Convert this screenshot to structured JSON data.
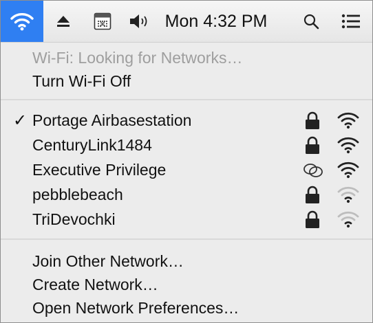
{
  "menubar": {
    "clock": "Mon 4:32 PM",
    "icons": [
      "wifi-icon",
      "eject-icon",
      "input-source-icon",
      "volume-icon",
      "spotlight-search-icon",
      "notification-list-icon"
    ]
  },
  "wifi_menu": {
    "status": "Wi-Fi: Looking for Networks…",
    "toggle": "Turn Wi-Fi Off",
    "check_mark": "✓",
    "networks": [
      {
        "name": "Portage Airbasestation",
        "selected": true,
        "security": "lock",
        "signal": 1.0
      },
      {
        "name": "CenturyLink1484",
        "selected": false,
        "security": "lock",
        "signal": 1.0
      },
      {
        "name": "Executive Privilege",
        "selected": false,
        "security": "linked",
        "signal": 1.0
      },
      {
        "name": "pebblebeach",
        "selected": false,
        "security": "lock",
        "signal": 0.5
      },
      {
        "name": "TriDevochki",
        "selected": false,
        "security": "lock",
        "signal": 0.5
      }
    ],
    "actions": {
      "join_other": "Join Other Network…",
      "create": "Create Network…",
      "preferences": "Open Network Preferences…"
    }
  },
  "colors": {
    "highlight": "#2f7ff2",
    "menu_bg": "#ececec",
    "disabled_text": "#9e9e9e",
    "text": "#111111",
    "weak_signal": "#bdbdbd"
  }
}
